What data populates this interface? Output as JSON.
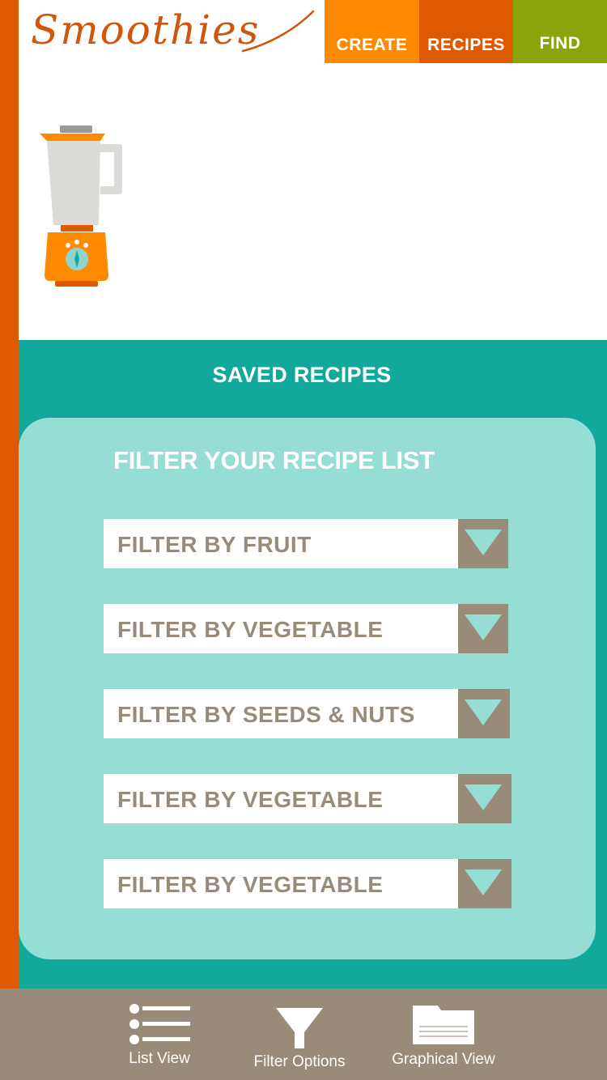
{
  "app": {
    "logo_text": "Smoothies"
  },
  "nav": {
    "tabs": [
      "CREATE",
      "RECIPES",
      "FIND"
    ]
  },
  "saved": {
    "title": "SAVED RECIPES"
  },
  "filter": {
    "title": "FILTER YOUR RECIPE LIST",
    "dropdowns": [
      "FILTER BY FRUIT",
      "FILTER BY VEGETABLE",
      "FILTER BY SEEDS & NUTS",
      "FILTER BY VEGETABLE",
      "FILTER BY VEGETABLE"
    ]
  },
  "bottom_bar": {
    "items": [
      "List View",
      "Filter Options",
      "Graphical View"
    ],
    "icons": [
      "list-icon",
      "funnel-icon",
      "folder-icon"
    ]
  },
  "colors": {
    "orange_dark": "#dd5a00",
    "orange": "#fd8a00",
    "olive": "#8da30e",
    "teal": "#13a89c",
    "teal_light": "#96ddd3",
    "taupe": "#988b7a"
  }
}
